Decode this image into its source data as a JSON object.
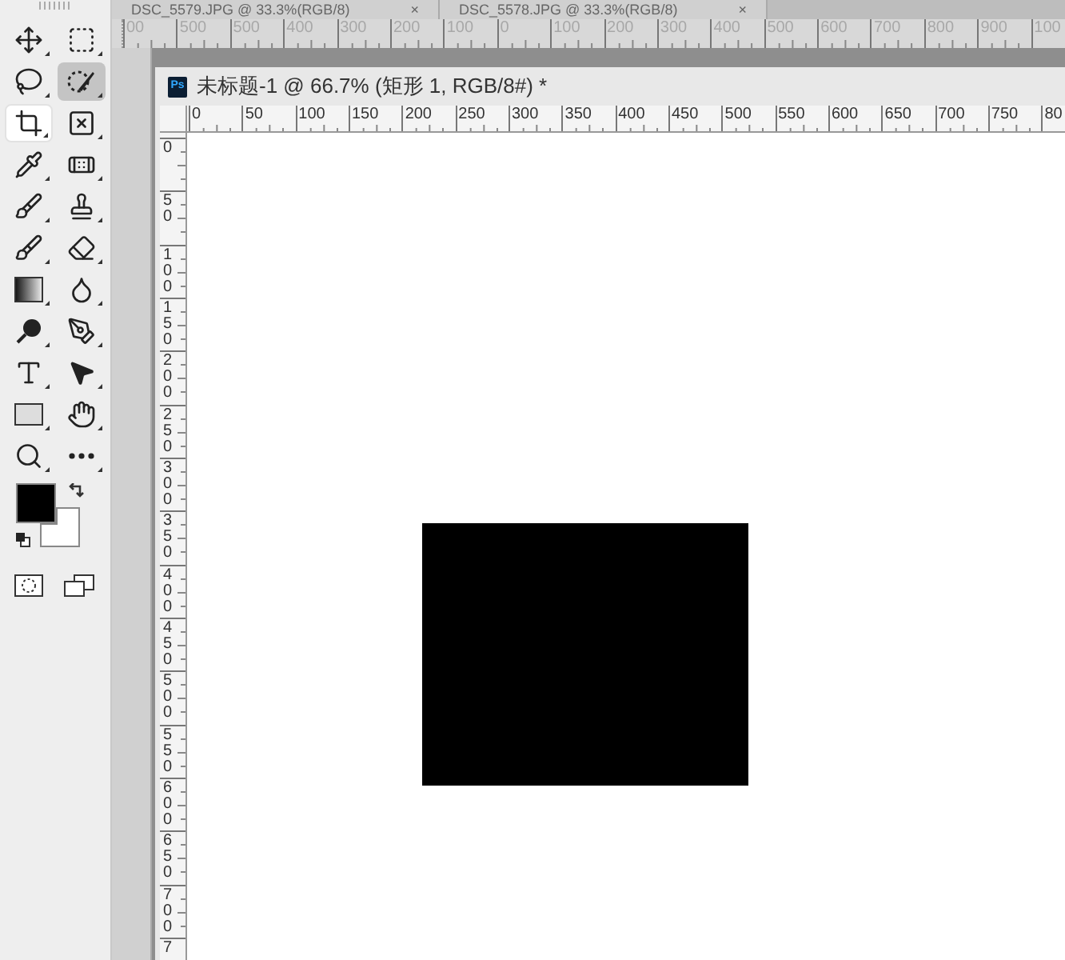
{
  "document_tabs": [
    {
      "title": "DSC_5579.JPG @ 33.3%(RGB/8)",
      "close": "×"
    },
    {
      "title": "DSC_5578.JPG @ 33.3%(RGB/8)",
      "close": "×"
    }
  ],
  "workspace_ruler": {
    "labels": [
      "00",
      "500",
      "500",
      "400",
      "300",
      "200",
      "100",
      "0",
      "100",
      "200",
      "300",
      "400",
      "500",
      "600",
      "700",
      "800",
      "900",
      "100"
    ]
  },
  "tools": [
    {
      "kind": "move",
      "selected": false,
      "highlighted": false
    },
    {
      "kind": "marquee",
      "selected": false,
      "highlighted": false
    },
    {
      "kind": "lasso",
      "selected": false,
      "highlighted": false
    },
    {
      "kind": "quick-selection",
      "selected": true,
      "highlighted": false
    },
    {
      "kind": "crop",
      "selected": false,
      "highlighted": true
    },
    {
      "kind": "frame",
      "selected": false,
      "highlighted": false
    },
    {
      "kind": "eyedropper",
      "selected": false,
      "highlighted": false
    },
    {
      "kind": "healing",
      "selected": false,
      "highlighted": false
    },
    {
      "kind": "brush",
      "selected": false,
      "highlighted": false
    },
    {
      "kind": "stamp",
      "selected": false,
      "highlighted": false
    },
    {
      "kind": "history-brush",
      "selected": false,
      "highlighted": false
    },
    {
      "kind": "eraser",
      "selected": false,
      "highlighted": false
    },
    {
      "kind": "gradient",
      "selected": false,
      "highlighted": false
    },
    {
      "kind": "blur",
      "selected": false,
      "highlighted": false
    },
    {
      "kind": "dodge",
      "selected": false,
      "highlighted": false
    },
    {
      "kind": "pen",
      "selected": false,
      "highlighted": false
    },
    {
      "kind": "type",
      "selected": false,
      "highlighted": false
    },
    {
      "kind": "path-select",
      "selected": false,
      "highlighted": false
    },
    {
      "kind": "rectangle",
      "selected": false,
      "highlighted": false
    },
    {
      "kind": "hand",
      "selected": false,
      "highlighted": false
    },
    {
      "kind": "zoom",
      "selected": false,
      "highlighted": false
    },
    {
      "kind": "more",
      "selected": false,
      "highlighted": false
    }
  ],
  "swatches": [
    {
      "kind": "foreground",
      "color": "#000000"
    },
    {
      "kind": "background",
      "color": "#ffffff"
    }
  ],
  "document": {
    "badge": "Ps",
    "title": "未标题-1 @ 66.7% (矩形 1, RGB/8#) *",
    "ruler_h": [
      "0",
      "50",
      "100",
      "150",
      "200",
      "250",
      "300",
      "350",
      "400",
      "450",
      "500",
      "550",
      "600",
      "650",
      "700",
      "750",
      "80"
    ],
    "ruler_v": [
      "0",
      "50",
      "100",
      "150",
      "200",
      "250",
      "300",
      "350",
      "400",
      "450",
      "500",
      "550",
      "600",
      "650",
      "700",
      "7"
    ],
    "shapes": [
      {
        "kind": "rectangle",
        "color": "#000000"
      }
    ]
  }
}
